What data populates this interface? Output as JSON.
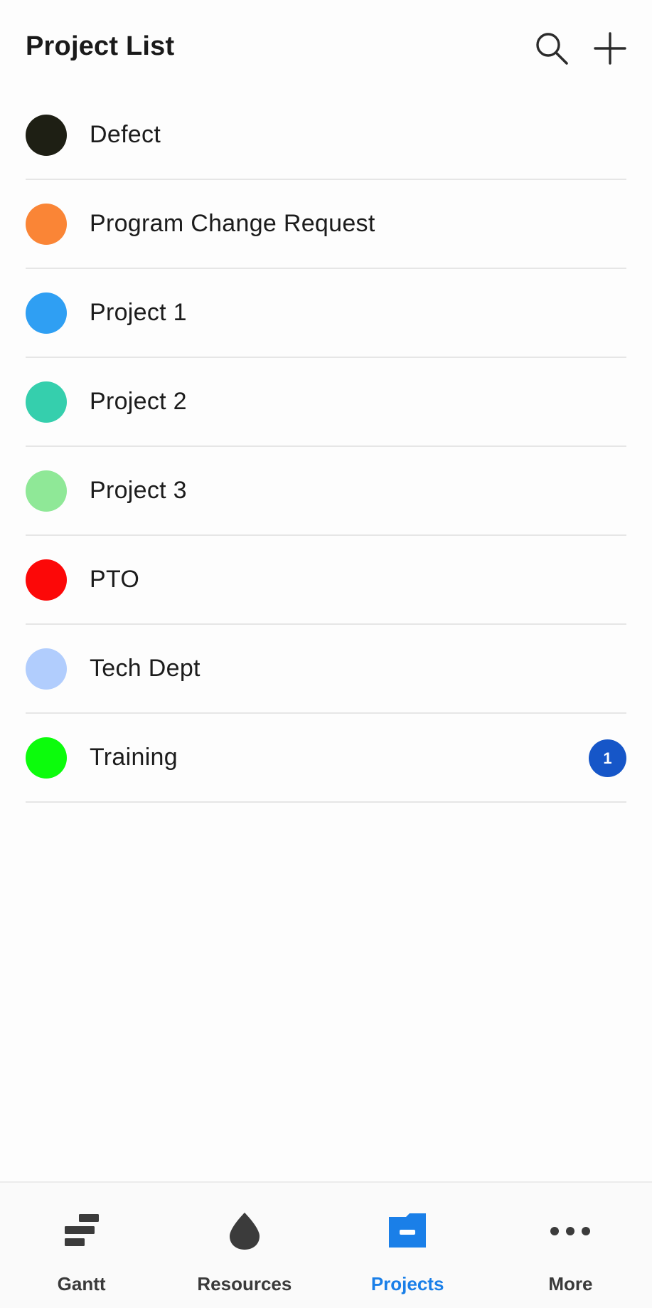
{
  "header": {
    "title": "Project List",
    "search_icon": "search-icon",
    "add_icon": "plus-icon"
  },
  "projects": [
    {
      "name": "Defect",
      "color": "#1e1f14"
    },
    {
      "name": "Program Change Request",
      "color": "#fa8536"
    },
    {
      "name": "Project 1",
      "color": "#2f9ff3"
    },
    {
      "name": "Project 2",
      "color": "#35cfad"
    },
    {
      "name": "Project 3",
      "color": "#8fe897"
    },
    {
      "name": "PTO",
      "color": "#fc0808"
    },
    {
      "name": "Tech Dept",
      "color": "#b1cdfd"
    },
    {
      "name": "Training",
      "color": "#0cfc0c",
      "badge": "1"
    }
  ],
  "badge_color": "#1656c8",
  "bottom_nav": {
    "active": "Projects",
    "active_color": "#1a7fe8",
    "items": [
      {
        "label": "Gantt",
        "icon": "gantt-icon"
      },
      {
        "label": "Resources",
        "icon": "droplet-icon"
      },
      {
        "label": "Projects",
        "icon": "folder-icon"
      },
      {
        "label": "More",
        "icon": "more-dots-icon"
      }
    ]
  }
}
